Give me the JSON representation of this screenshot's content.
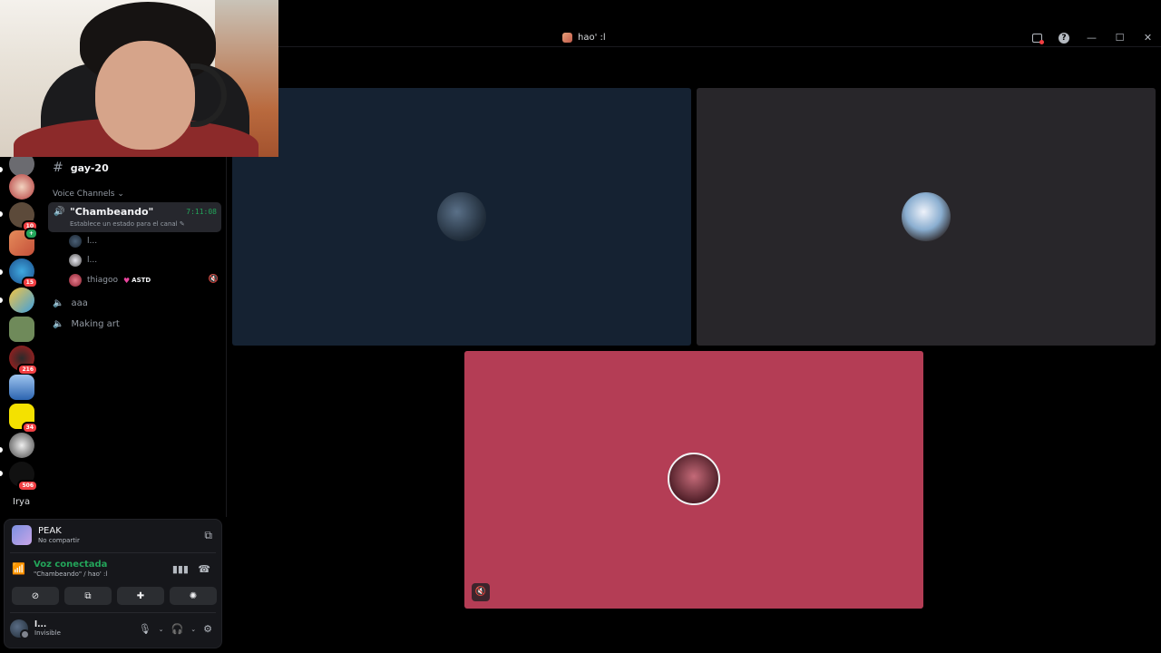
{
  "window": {
    "title": "hao' :l"
  },
  "channel_list": {
    "text_channel": "gay-20",
    "voice_category": "Voice Channels",
    "active_voice": {
      "name": "\"Chambeando\"",
      "status_placeholder": "Establece un estado para el canal",
      "timer": "7:11:08",
      "users": [
        {
          "name": "l..."
        },
        {
          "name": "l..."
        },
        {
          "name": "thiagoo",
          "tag": "ASTD"
        }
      ]
    },
    "other_voice": [
      "aaa",
      "Making art"
    ]
  },
  "servers": {
    "badges": [
      "10",
      "15",
      "216",
      "34",
      "506"
    ],
    "text_icon": "Irya"
  },
  "panel": {
    "activity": {
      "title": "PEAK",
      "subtitle": "No compartir"
    },
    "voice": {
      "title": "Voz conectada",
      "subtitle": "\"Chambeando\" / hao' :l"
    },
    "user": {
      "name": "l...",
      "status": "Invisible"
    }
  },
  "icons": [
    "speaker-icon",
    "hash-icon",
    "mute-icon",
    "screen-share-icon",
    "activity-icon",
    "soundboard-icon",
    "mic-icon",
    "headphones-icon",
    "gear-icon",
    "disconnect-icon"
  ],
  "colors": {
    "accent_green": "#23a55a",
    "tile_blue": "#152232",
    "tile_gray": "#28262a",
    "tile_pink": "#b43d55"
  }
}
